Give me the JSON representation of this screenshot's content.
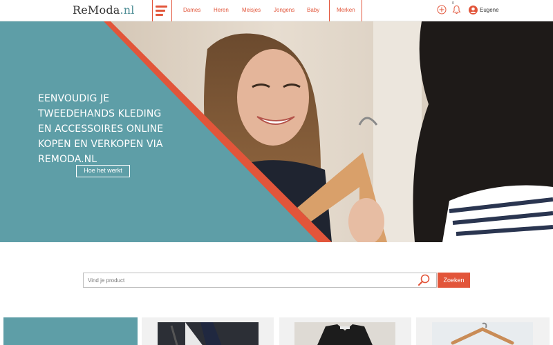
{
  "logo": {
    "name": "ReModa",
    "tld": ".nl"
  },
  "nav": {
    "items": [
      "Dames",
      "Heren",
      "Meisjes",
      "Jongens",
      "Baby"
    ],
    "brands": "Merken"
  },
  "header": {
    "notification_count": "0",
    "user_name": "Eugene"
  },
  "hero": {
    "lines": [
      "EENVOUDIG JE",
      "TWEEDEHANDS KLEDING",
      "EN ACCESSOIRES ONLINE",
      "KOPEN EN VERKOPEN VIA",
      "REMODA.NL"
    ],
    "button": "Hoe het werkt"
  },
  "search": {
    "placeholder": "Vind je product",
    "button": "Zoeken"
  },
  "colors": {
    "accent": "#e2553a",
    "teal": "#5e9ea7"
  },
  "icons": [
    "menu-icon",
    "add-circle-icon",
    "bell-icon",
    "user-icon",
    "search-icon"
  ]
}
